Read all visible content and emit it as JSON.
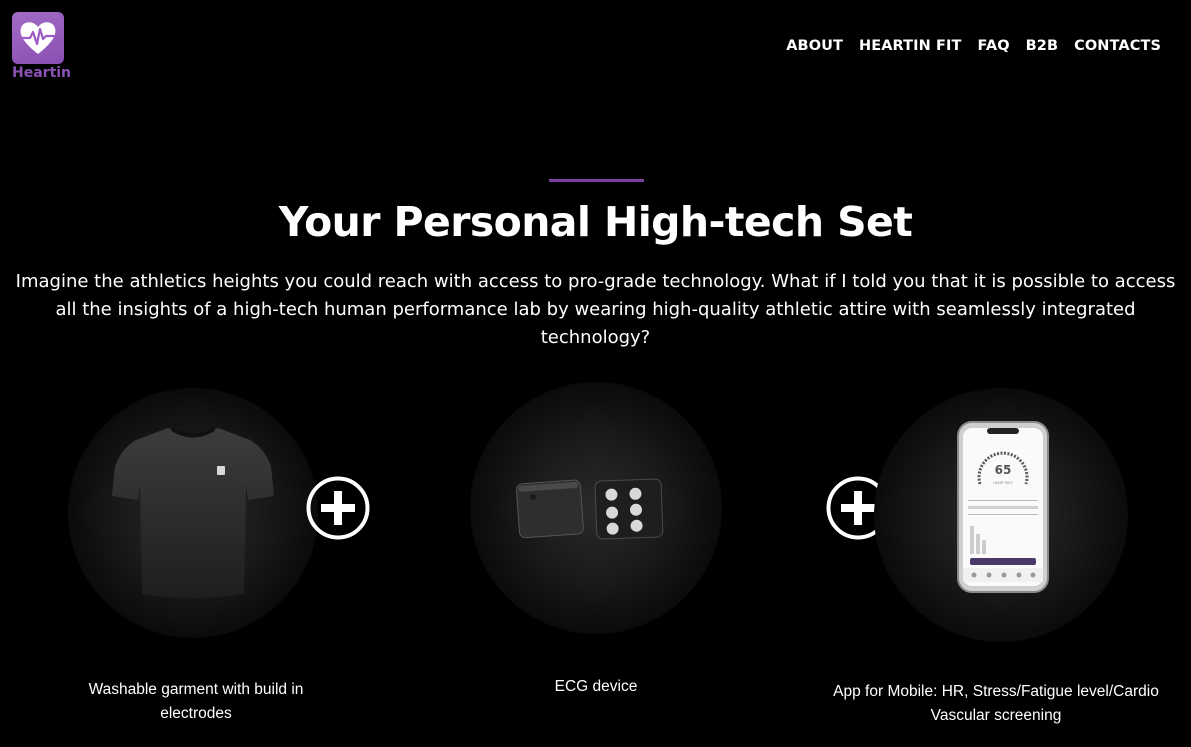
{
  "brand": {
    "name": "Heartin",
    "accent_color": "#8a4fb3"
  },
  "nav": {
    "items": [
      {
        "label": "ABOUT"
      },
      {
        "label": "HEARTIN FIT"
      },
      {
        "label": "FAQ"
      },
      {
        "label": "B2B"
      },
      {
        "label": "CONTACTS"
      }
    ]
  },
  "hero": {
    "title": "Your Personal High-tech Set",
    "intro": "Imagine the athletics heights you could reach with access to pro-grade technology. What if I told you that it is possible to access all the insights of a high-tech human performance lab by wearing high-quality athletic attire with seamlessly integrated technology?"
  },
  "products": [
    {
      "icon": "tshirt-image",
      "caption": "Washable garment with build in electrodes"
    },
    {
      "icon": "ecg-device-image",
      "caption": "ECG device"
    },
    {
      "icon": "mobile-app-image",
      "caption": "App for Mobile: HR, Stress/Fatigue level/Cardio Vascular screening",
      "phone_reading": "65"
    }
  ]
}
